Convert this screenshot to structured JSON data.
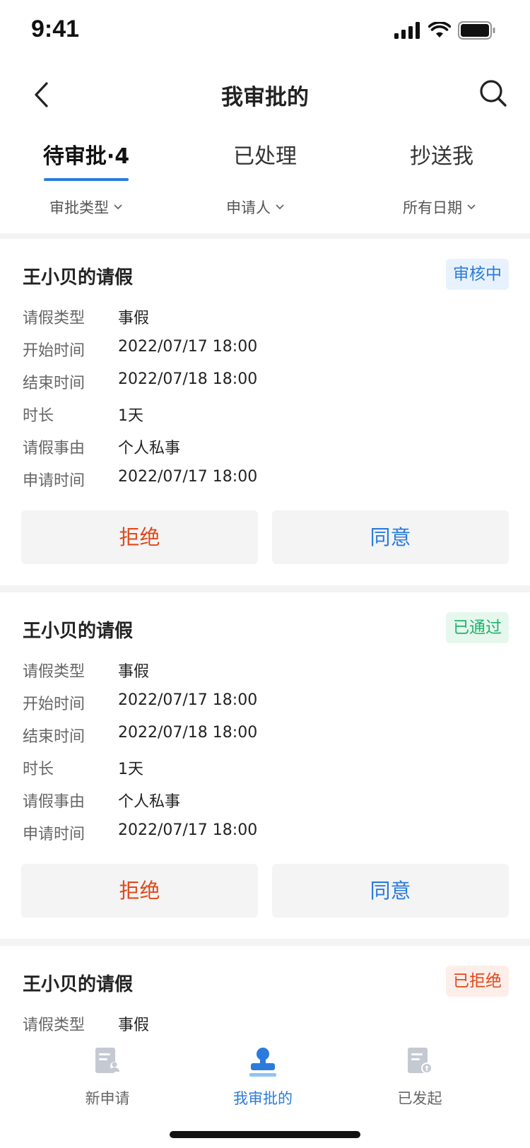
{
  "status_bar": {
    "time": "9:41"
  },
  "nav": {
    "title": "我审批的"
  },
  "tabs": [
    {
      "label": "待审批·4",
      "active": true
    },
    {
      "label": "已处理",
      "active": false
    },
    {
      "label": "抄送我",
      "active": false
    }
  ],
  "filters": [
    {
      "label": "审批类型"
    },
    {
      "label": "申请人"
    },
    {
      "label": "所有日期"
    }
  ],
  "cards": [
    {
      "title": "王小贝的请假",
      "status": "审核中",
      "status_color": "#2b7bdc",
      "status_bg": "#e8f2ff",
      "rows": [
        {
          "label": "请假类型",
          "value": "事假"
        },
        {
          "label": "开始时间",
          "value": "2022/07/17 18:00"
        },
        {
          "label": "结束时间",
          "value": "2022/07/18 18:00"
        },
        {
          "label": "时长",
          "value": "1天"
        },
        {
          "label": "请假事由",
          "value": "个人私事"
        },
        {
          "label": "申请时间",
          "value": "2022/07/17 18:00"
        }
      ],
      "reject_label": "拒绝",
      "approve_label": "同意"
    },
    {
      "title": "王小贝的请假",
      "status": "已通过",
      "status_color": "#1fb36a",
      "status_bg": "#e6f7ee",
      "rows": [
        {
          "label": "请假类型",
          "value": "事假"
        },
        {
          "label": "开始时间",
          "value": "2022/07/17 18:00"
        },
        {
          "label": "结束时间",
          "value": "2022/07/18 18:00"
        },
        {
          "label": "时长",
          "value": "1天"
        },
        {
          "label": "请假事由",
          "value": "个人私事"
        },
        {
          "label": "申请时间",
          "value": "2022/07/17 18:00"
        }
      ],
      "reject_label": "拒绝",
      "approve_label": "同意"
    },
    {
      "title": "王小贝的请假",
      "status": "已拒绝",
      "status_color": "#e0491b",
      "status_bg": "#fdeeea",
      "rows": [
        {
          "label": "请假类型",
          "value": "事假"
        }
      ]
    }
  ],
  "tabbar": [
    {
      "label": "新申请",
      "icon": "new-application-icon",
      "active": false
    },
    {
      "label": "我审批的",
      "icon": "my-approvals-icon",
      "active": true
    },
    {
      "label": "已发起",
      "icon": "submitted-icon",
      "active": false
    }
  ],
  "colors": {
    "accent": "#2b7bdc",
    "reject": "#e0491b",
    "approved": "#1fb36a"
  }
}
